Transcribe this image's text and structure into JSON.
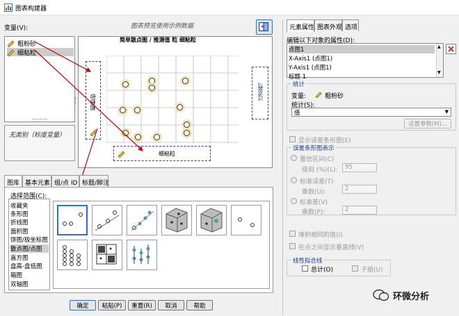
{
  "window": {
    "title": "图表构建器"
  },
  "left": {
    "variables_label": "变量(V):",
    "preview_hint": "图表预览使用示例数据",
    "variables": [
      {
        "name": "粗粉砂",
        "selected": false
      },
      {
        "name": "细粘粒",
        "selected": true
      }
    ],
    "no_category_text": "无类别（标度变量）",
    "canvas": {
      "title": "简单散点图 / 推测值 粒 细粘粒",
      "y_drop_label": "粗粉砂",
      "x_drop_label": "细粘粒",
      "right_drop_label": "过滤器?"
    },
    "tabs": [
      "图库",
      "基本元素",
      "组/点 ID",
      "标题/脚注"
    ],
    "choose_from_label": "选择范围(C):",
    "categories": [
      "收藏夹",
      "条形图",
      "折线图",
      "面积图",
      "饼图/极坐标图",
      "散点图/点图",
      "直方图",
      "盘高-盘低图",
      "箱图",
      "双轴图"
    ],
    "selected_category": "散点图/点图",
    "thumbnail_icons": [
      "simple-scatter-icon",
      "scatter-fit-line-icon",
      "grouped-scatter-icon",
      "3d-scatter-icon",
      "3d-grouped-scatter-icon",
      "summary-point-icon",
      "dot-plot-icon",
      "scatter-matrix-icon",
      "drop-line-icon"
    ]
  },
  "buttons": {
    "ok": "确定",
    "paste": "粘贴(P)",
    "reset": "重置(R)",
    "cancel": "取消",
    "help": "帮助"
  },
  "right": {
    "tabs": [
      "元素属性",
      "图表外观",
      "选项"
    ],
    "edit_label": "编辑以下对象的属性(D):",
    "properties": [
      "点图1",
      "X-Axis1 (点图1)",
      "Y-Axis1 (点图1)",
      "标题 1"
    ],
    "selected_property": "点图1",
    "stats_legend": "统计",
    "variable_label": "变量:",
    "variable_value": "粗粉砂",
    "stat_label": "统计(S):",
    "stat_value": "值",
    "set_params_button": "设置参数(M)...",
    "show_error_bars": "显示误差条形图(E)",
    "error_bars_legend": "误差条形图表示",
    "ci_label": "置信区间(C)",
    "level_label": "级别 (%)(L):",
    "level_value": "95",
    "se_label": "标准误差(T)",
    "multiplier_label_1": "乘数(U):",
    "multiplier_value_1": "2",
    "sd_label": "标准差(V)",
    "multiplier_label_2": "乘数(P):",
    "multiplier_value_2": "2",
    "stack_label": "堆积相同的值(I)",
    "drop_line_label": "在点之间显示垂直线(V)",
    "fit_legend": "线性拟合线",
    "total_label": "总计(O)",
    "subgroup_label": "子组(U)"
  },
  "watermark": {
    "text": "环微分析"
  },
  "colors": {
    "accent": "#2a6fd0",
    "drop_zone": "#3a3aa0",
    "arrow": "#c00000",
    "marker_halo": "#f3e6b4",
    "delete_x": "#d03030"
  }
}
